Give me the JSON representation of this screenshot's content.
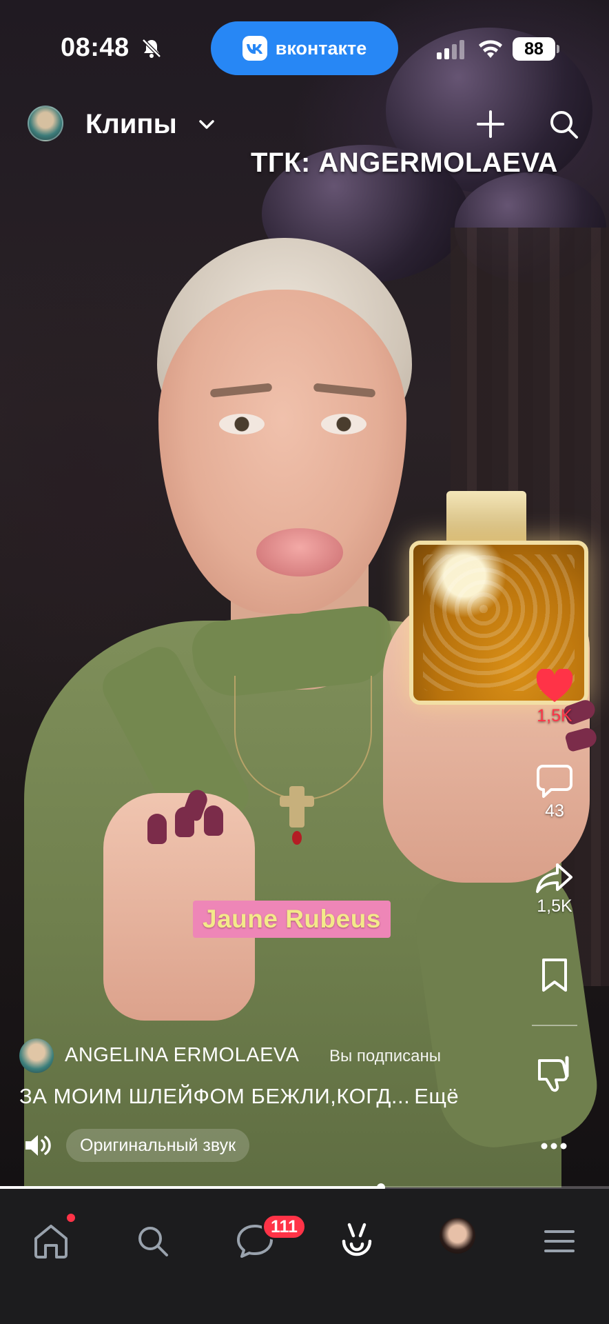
{
  "status_bar": {
    "time": "08:48",
    "app_pill_label": "вконтакте",
    "battery": "88"
  },
  "header": {
    "title": "Клипы"
  },
  "video": {
    "overlay_text": "ТГК: ANGERMOLAEVA",
    "sticker_text": "Jaune Rubeus"
  },
  "actions": {
    "likes": "1,5K",
    "comments": "43",
    "shares": "1,5K"
  },
  "post": {
    "author": "ANGELINA ERMOLAEVA",
    "subscription_status": "Вы подписаны",
    "caption": "ЗА МОИМ ШЛЕЙФОМ БЕЖЛИ,КОГД...",
    "more_label": "Ещё",
    "sound_label": "Оригинальный звук",
    "progress": 0.625
  },
  "tabbar": {
    "messages_badge": "111"
  },
  "colors": {
    "accent": "#2787f5",
    "like": "#ff3347",
    "badge": "#ff3347",
    "tabbar_bg": "#1c1c1e"
  }
}
